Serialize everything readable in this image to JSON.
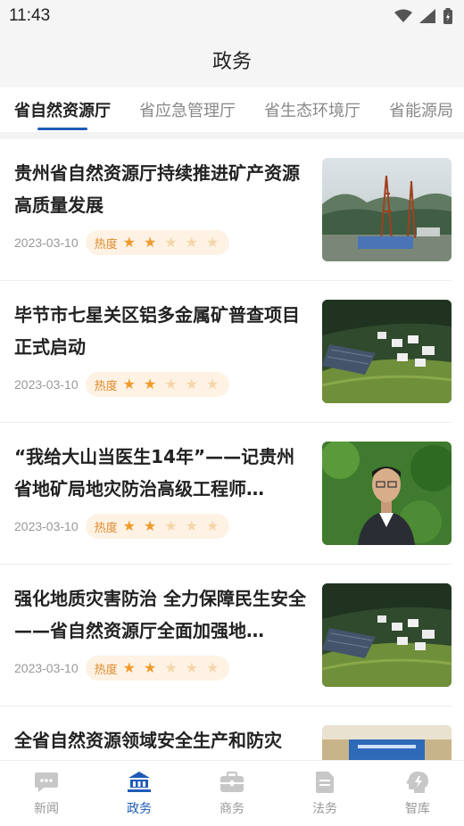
{
  "status_bar": {
    "time": "11:43"
  },
  "header": {
    "title": "政务"
  },
  "tabs": [
    {
      "label": "省自然资源厅",
      "active": true
    },
    {
      "label": "省应急管理厅",
      "active": false
    },
    {
      "label": "省生态环境厅",
      "active": false
    },
    {
      "label": "省能源局",
      "active": false
    }
  ],
  "articles": [
    {
      "title": "贵州省自然资源厅持续推进矿产资源高质量发展",
      "date": "2023-03-10",
      "heat_label": "热度",
      "heat_stars": 2,
      "heat_max": 5,
      "image": "drilling-rig-landscape"
    },
    {
      "title": "毕节市七星关区铝多金属矿普查项目正式启动",
      "date": "2023-03-10",
      "heat_label": "热度",
      "heat_stars": 2,
      "heat_max": 5,
      "image": "village-aerial-view"
    },
    {
      "title": "“我给大山当医生14年”——记贵州省地矿局地灾防治高级工程师…",
      "date": "2023-03-10",
      "heat_label": "热度",
      "heat_stars": 2,
      "heat_max": 5,
      "image": "engineer-portrait"
    },
    {
      "title": "强化地质灾害防治 全力保障民生安全——省自然资源厅全面加强地…",
      "date": "2023-03-10",
      "heat_label": "热度",
      "heat_stars": 2,
      "heat_max": 5,
      "image": "village-aerial-view"
    },
    {
      "title": "全省自然资源领域安全生产和防灾",
      "date": "",
      "heat_label": "",
      "heat_stars": 0,
      "heat_max": 0,
      "image": "meeting-room"
    }
  ],
  "tabbar": [
    {
      "label": "新闻",
      "icon": "chat-icon",
      "active": false
    },
    {
      "label": "政务",
      "icon": "government-building-icon",
      "active": true
    },
    {
      "label": "商务",
      "icon": "briefcase-icon",
      "active": false
    },
    {
      "label": "法务",
      "icon": "document-icon",
      "active": false
    },
    {
      "label": "智库",
      "icon": "brain-icon",
      "active": false
    }
  ],
  "colors": {
    "accent": "#1e5bb8",
    "star_on": "#f19a2a",
    "star_off": "#f5d6a9",
    "heat_bg": "#fdf2e4"
  }
}
